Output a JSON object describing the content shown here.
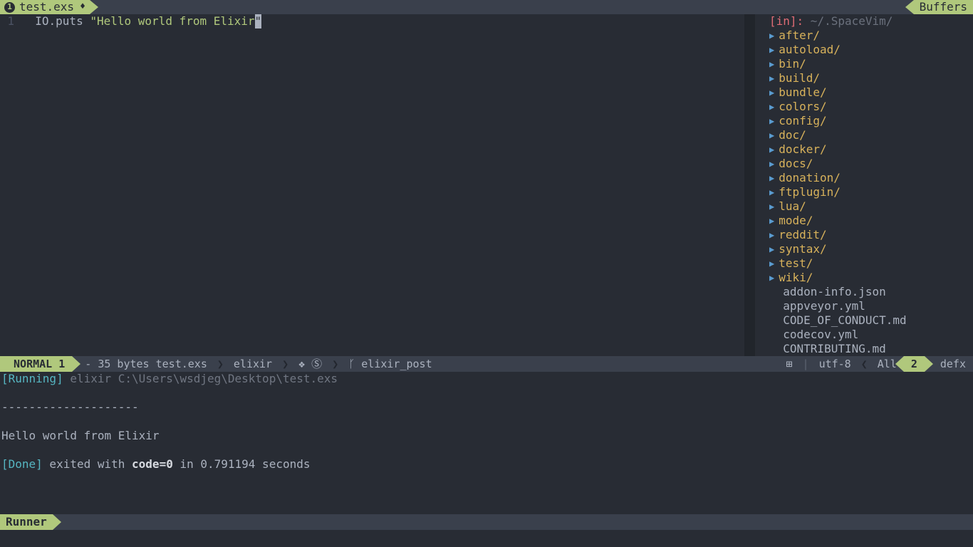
{
  "tab": {
    "index": "1",
    "filename": "test.exs"
  },
  "buffers_label": "Buffers",
  "editor": {
    "line_number": "1",
    "code_ident": "IO.puts",
    "code_space": " ",
    "code_q1": "\"",
    "code_str": "Hello world from Elixir",
    "code_q2": "\""
  },
  "tree": {
    "in_label": "[in]:",
    "in_path": " ~/.SpaceVim/",
    "dirs": [
      "after/",
      "autoload/",
      "bin/",
      "build/",
      "bundle/",
      "colors/",
      "config/",
      "doc/",
      "docker/",
      "docs/",
      "donation/",
      "ftplugin/",
      "lua/",
      "mode/",
      "reddit/",
      "syntax/",
      "test/",
      "wiki/"
    ],
    "files": [
      "addon-info.json",
      "appveyor.yml",
      "CODE_OF_CONDUCT.md",
      "codecov.yml",
      "CONTRIBUTING.md"
    ]
  },
  "status": {
    "mode": " NORMAL ",
    "mode_win": "1",
    "fileinfo": "- 35 bytes test.exs",
    "filetype": "elixir",
    "icons": "❖ Ⓢ",
    "branch_icon": "ᚴ",
    "branch": " elixir_post",
    "os_icon": "⊞",
    "encoding": "utf-8",
    "percent": "All",
    "win2": "2",
    "defx": "defx"
  },
  "runner": {
    "running_tag": "[Running]",
    "running_cmd": " elixir C:\\Users\\wsdjeg\\Desktop\\test.exs",
    "dashes": "--------------------",
    "output": "Hello world from Elixir",
    "done_tag": "[Done]",
    "done_pre": " exited with ",
    "done_code": "code=0",
    "done_post": " in 0.791194 seconds",
    "label": "Runner"
  }
}
